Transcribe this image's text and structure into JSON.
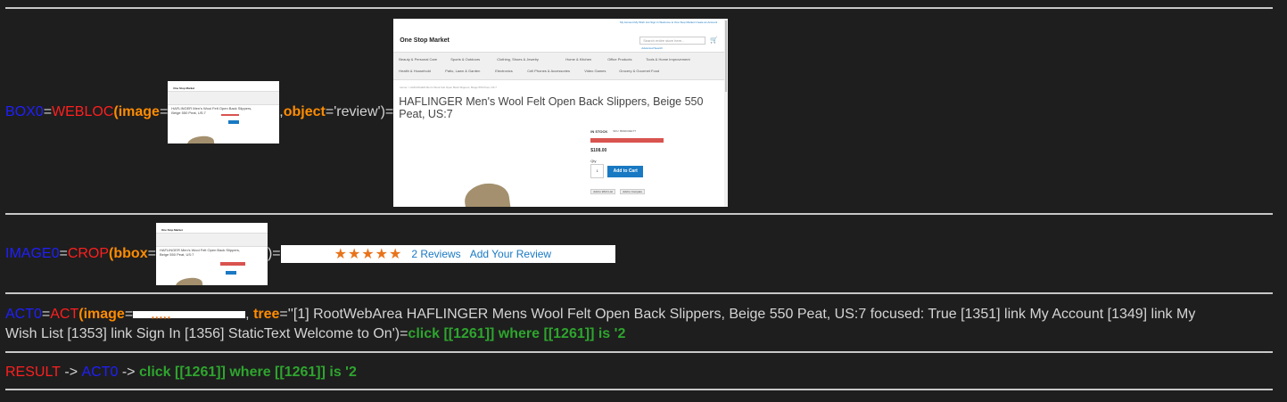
{
  "box_row": {
    "var": "BOX0",
    "eq": "=",
    "func": "WEBLOC",
    "open": "(",
    "image_kw": "image",
    "comma": ", ",
    "object_kw": "object",
    "object_val": "='review')=",
    "eq2": "="
  },
  "webpage": {
    "top_links": "My Account   My Wish List   Sign In   Welcome to One Stop Market   Create an Account",
    "logo": "One Stop Market",
    "search_placeholder": "Search entire store here...",
    "advanced_search": "Advanced Search",
    "nav_row1": [
      "Beauty & Personal Care",
      "Sports & Outdoors",
      "Clothing, Shoes & Jewelry",
      "Home & Kitchen",
      "Office Products",
      "Tools & Home Improvement"
    ],
    "nav_row2": [
      "Health & Household",
      "Patio, Lawn & Garden",
      "Electronics",
      "Cell Phones & Accessories",
      "Video Games",
      "Grocery & Gourmet Food"
    ],
    "breadcrumb": "Home > HAFLINGER Men's Wool Felt Open Back Slippers, Beige 550 Peat, US:7",
    "product_title": "HAFLINGER Men's Wool Felt Open Back Slippers, Beige 550 Peat, US:7",
    "stock": "IN STOCK",
    "sku": "SKU: B002C0E1T7",
    "price": "$108.00",
    "qty_label": "Qty",
    "qty_value": "1",
    "add_to_cart": "Add to Cart",
    "add_wish": "Add to Wish List",
    "add_compare": "Add to Compare"
  },
  "crop_row": {
    "var": "IMAGE0",
    "eq": "=",
    "func": "CROP",
    "open": "(",
    "bbox_kw": "bbox",
    "eq2": "=",
    "close": ")="
  },
  "crop_image": {
    "stars": "★★★★★",
    "reviews": "2  Reviews",
    "add_review": "Add Your Review"
  },
  "act_row": {
    "var": "ACT0",
    "eq": "=",
    "func": "ACT",
    "open": "(",
    "image_kw": "image",
    "eq2": "=",
    "comma": ", ",
    "tree_kw": "tree",
    "tree_line1": "=''[1] RootWebArea HAFLINGER Mens Wool Felt Open Back Slippers, Beige 550 Peat, US:7 focused: True [1351] link My Account [1349] link My",
    "tree_line2": "Wish List [1353] link Sign In [1356] StaticText Welcome to On')=",
    "result": "click [[1261]] where [[1261]] is '2"
  },
  "result_row": {
    "label": "RESULT",
    "arrow1": " -> ",
    "var": "ACT0",
    "arrow2": " -> ",
    "value": "click [[1261]] where [[1261]] is '2"
  },
  "colors": {
    "background": "#1e1e1e",
    "variable": "#1f1fff",
    "function": "#ff1f1f",
    "keyword": "#ff8c00",
    "result": "#2ea52e",
    "separator": "#c8c8c8"
  }
}
